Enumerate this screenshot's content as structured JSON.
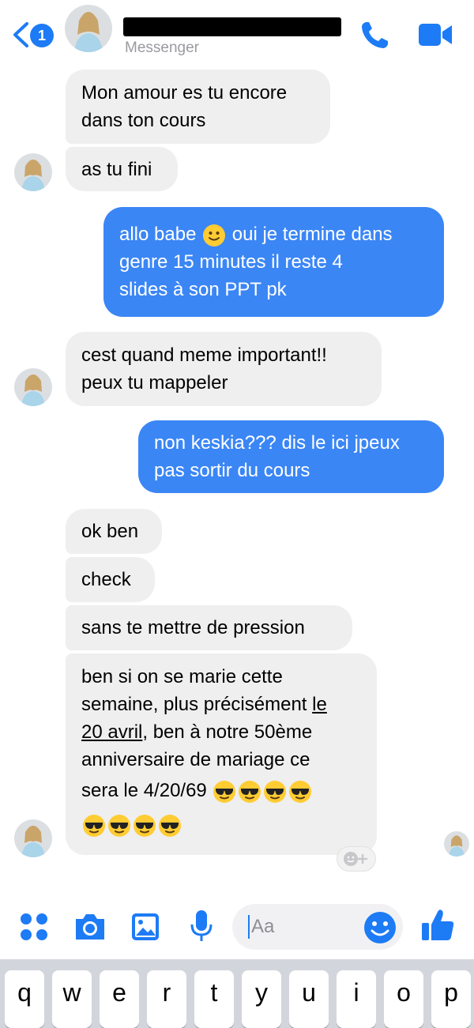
{
  "header": {
    "back_badge": "1",
    "subtitle": "Messenger"
  },
  "colors": {
    "accent": "#1d7bf5",
    "outgoing_bubble": "#3b86f5",
    "incoming_bubble": "#efefef"
  },
  "messages": {
    "m1": {
      "text": "Mon amour es tu encore\ndans ton cours"
    },
    "m2": {
      "text": "as tu fini"
    },
    "m3": {
      "text_a": "allo babe ",
      "text_b": " oui je termine dans\ngenre 15 minutes il reste 4\nslides à son PPT pk"
    },
    "m4": {
      "text": "cest quand meme important!!\npeux tu mappeler"
    },
    "m5": {
      "text": "non keskia??? dis le ici jpeux\npas sortir du cours"
    },
    "m6": {
      "text": "ok ben"
    },
    "m7": {
      "text": "check"
    },
    "m8": {
      "text": "sans te mettre de pression"
    },
    "m9": {
      "line1": "ben si on se marie cette",
      "line2_a": "semaine, plus précisément ",
      "line2_link": "le",
      "line3_link": "20 avril",
      "line3_b": ", ben à notre 50ème",
      "line4": "anniversaire de mariage ce",
      "line5": "sera le 4/20/69 "
    }
  },
  "composer": {
    "placeholder": "Aa"
  },
  "keyboard": {
    "keys": [
      "q",
      "w",
      "e",
      "r",
      "t",
      "y",
      "u",
      "i",
      "o",
      "p"
    ]
  }
}
